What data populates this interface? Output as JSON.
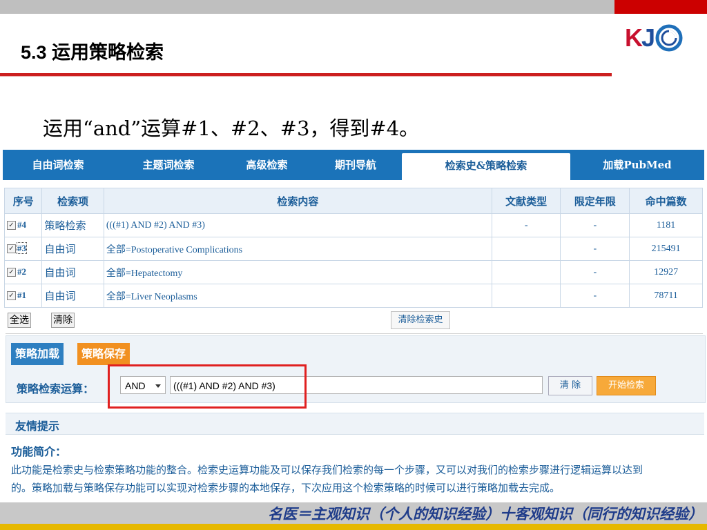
{
  "slide": {
    "title": "5.3 运用策略检索",
    "caption": "运用“and”运算#1、#2、#3，得到#4。",
    "logo": {
      "letters": "KJ",
      "k": "K",
      "j": "J",
      "brand_red": "#c8102e",
      "brand_blue": "#1f4e9c"
    },
    "footer": "名医＝主观知识（个人的知识经验）十客观知识（同行的知识经验）"
  },
  "tabs": [
    {
      "label": "自由词检索"
    },
    {
      "label": "主题词检索"
    },
    {
      "label": "高级检索"
    },
    {
      "label": "期刊导航"
    },
    {
      "label": "检索史&策略检索",
      "active": true
    },
    {
      "label": "加载PubMed"
    }
  ],
  "table": {
    "headers": [
      "序号",
      "检索项",
      "检索内容",
      "文献类型",
      "限定年限",
      "命中篇数"
    ],
    "rows": [
      {
        "id": "#4",
        "item": "策略检索",
        "content": "(((#1) AND #2) AND #3)",
        "doctype": "-",
        "years": "-",
        "hits": "1181"
      },
      {
        "id": "#3",
        "item": "自由词",
        "content": "全部=Postoperative Complications",
        "doctype": "",
        "years": "-",
        "hits": "215491"
      },
      {
        "id": "#2",
        "item": "自由词",
        "content": "全部=Hepatectomy",
        "doctype": "",
        "years": "-",
        "hits": "12927"
      },
      {
        "id": "#1",
        "item": "自由词",
        "content": "全部=Liver Neoplasms",
        "doctype": "",
        "years": "-",
        "hits": "78711"
      }
    ]
  },
  "controls": {
    "select_all": "全选",
    "clear": "清除",
    "clear_history": "清除检索史",
    "load_strategy": "策略加载",
    "save_strategy": "策略保存",
    "expr_label": "策略检索运算：",
    "operator": "AND",
    "expression": "(((#1) AND #2) AND #3)",
    "clear_btn": "清 除",
    "search_btn": "开始检索"
  },
  "tips": {
    "title": "友情提示",
    "func_title": "功能简介：",
    "line1": "此功能是检索史与检索策略功能的整合。检索史运算功能及可以保存我们检索的每一个步骤，又可以对我们的检索步骤进行逻辑运算以达到",
    "line2": "的。策略加载与策略保存功能可以实现对检索步骤的本地保存，下次应用这个检索策略的时候可以进行策略加载去完成。"
  }
}
